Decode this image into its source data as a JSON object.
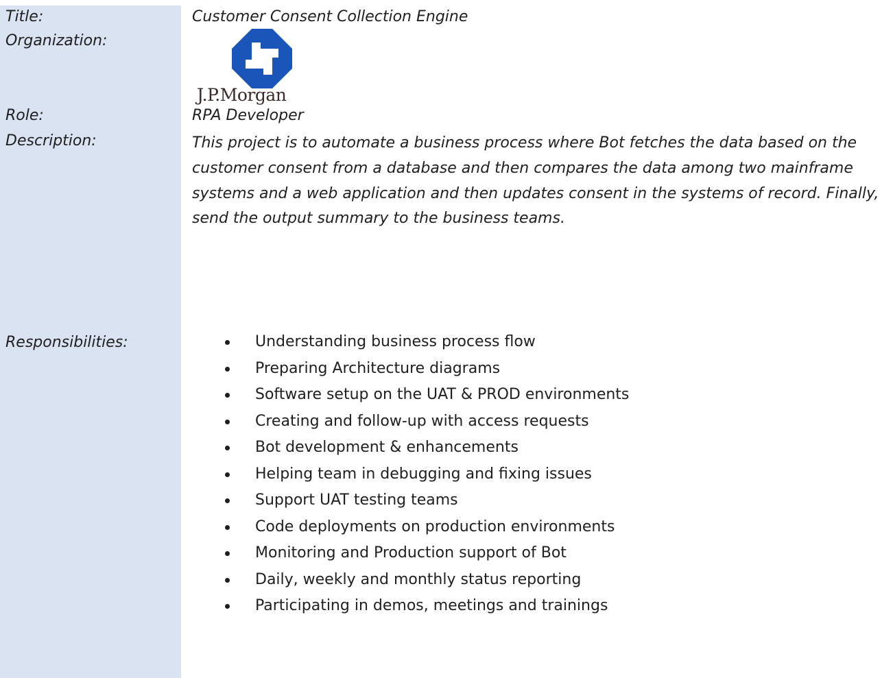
{
  "labels": {
    "title": "Title:",
    "organization": "Organization:",
    "role": "Role:",
    "description": "Description:",
    "responsibilities": "Responsibilities:"
  },
  "project": {
    "title": "Customer Consent Collection Engine",
    "organization_logo_text": "J.P.Morgan",
    "logo_icon": "jpmorgan-octagon-logo",
    "logo_color": "#1a56b9",
    "role": "RPA Developer",
    "description": "This project is to automate a business process where Bot fetches the data based on the customer consent from a database and then compares the data among two mainframe systems and a web application and then updates consent in the systems of record. Finally, send the output summary to the business teams."
  },
  "responsibilities": [
    "Understanding business process flow",
    "Preparing Architecture diagrams",
    "Software setup on the UAT & PROD environments",
    "Creating and follow-up with access requests",
    "Bot development & enhancements",
    "Helping team in debugging and fixing issues",
    "Support UAT testing teams",
    "Code deployments on production environments",
    "Monitoring and Production support of Bot",
    "Daily, weekly and monthly status reporting",
    "Participating in demos, meetings and trainings"
  ],
  "colors": {
    "label_column_background": "#dae3f2",
    "text": "#1f1f1f"
  }
}
